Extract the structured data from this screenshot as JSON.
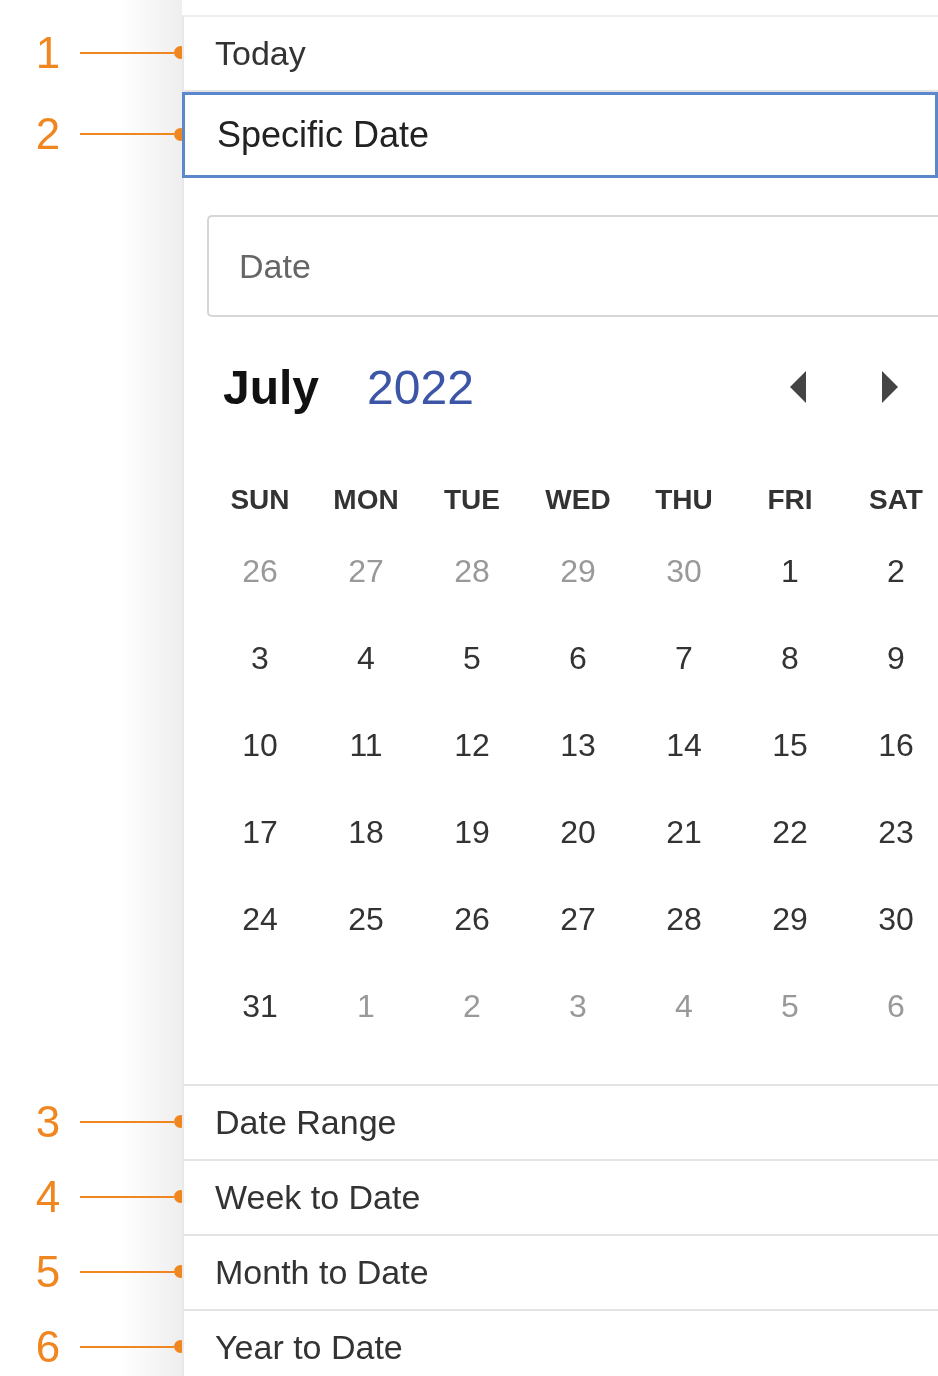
{
  "options": [
    {
      "label": "Today",
      "callout": "1",
      "selected": false
    },
    {
      "label": "Specific Date",
      "callout": "2",
      "selected": true
    },
    {
      "label": "Date Range",
      "callout": "3",
      "selected": false
    },
    {
      "label": "Week to Date",
      "callout": "4",
      "selected": false
    },
    {
      "label": "Month to Date",
      "callout": "5",
      "selected": false
    },
    {
      "label": "Year to Date",
      "callout": "6",
      "selected": false
    }
  ],
  "date_picker": {
    "field": {
      "placeholder": "Date"
    },
    "month": "July",
    "year": "2022",
    "weekdays": [
      "SUN",
      "MON",
      "TUE",
      "WED",
      "THU",
      "FRI",
      "SAT"
    ],
    "weeks": [
      [
        {
          "day": "26",
          "outside": true
        },
        {
          "day": "27",
          "outside": true
        },
        {
          "day": "28",
          "outside": true
        },
        {
          "day": "29",
          "outside": true
        },
        {
          "day": "30",
          "outside": true
        },
        {
          "day": "1",
          "outside": false
        },
        {
          "day": "2",
          "outside": false
        }
      ],
      [
        {
          "day": "3",
          "outside": false
        },
        {
          "day": "4",
          "outside": false
        },
        {
          "day": "5",
          "outside": false
        },
        {
          "day": "6",
          "outside": false
        },
        {
          "day": "7",
          "outside": false
        },
        {
          "day": "8",
          "outside": false
        },
        {
          "day": "9",
          "outside": false
        }
      ],
      [
        {
          "day": "10",
          "outside": false
        },
        {
          "day": "11",
          "outside": false
        },
        {
          "day": "12",
          "outside": false
        },
        {
          "day": "13",
          "outside": false
        },
        {
          "day": "14",
          "outside": false
        },
        {
          "day": "15",
          "outside": false
        },
        {
          "day": "16",
          "outside": false
        }
      ],
      [
        {
          "day": "17",
          "outside": false
        },
        {
          "day": "18",
          "outside": false
        },
        {
          "day": "19",
          "outside": false
        },
        {
          "day": "20",
          "outside": false
        },
        {
          "day": "21",
          "outside": false
        },
        {
          "day": "22",
          "outside": false
        },
        {
          "day": "23",
          "outside": false
        }
      ],
      [
        {
          "day": "24",
          "outside": false
        },
        {
          "day": "25",
          "outside": false
        },
        {
          "day": "26",
          "outside": false
        },
        {
          "day": "27",
          "outside": false
        },
        {
          "day": "28",
          "outside": false
        },
        {
          "day": "29",
          "outside": false
        },
        {
          "day": "30",
          "outside": false
        }
      ],
      [
        {
          "day": "31",
          "outside": false
        },
        {
          "day": "1",
          "outside": true
        },
        {
          "day": "2",
          "outside": true
        },
        {
          "day": "3",
          "outside": true
        },
        {
          "day": "4",
          "outside": true
        },
        {
          "day": "5",
          "outside": true
        },
        {
          "day": "6",
          "outside": true
        }
      ]
    ]
  }
}
